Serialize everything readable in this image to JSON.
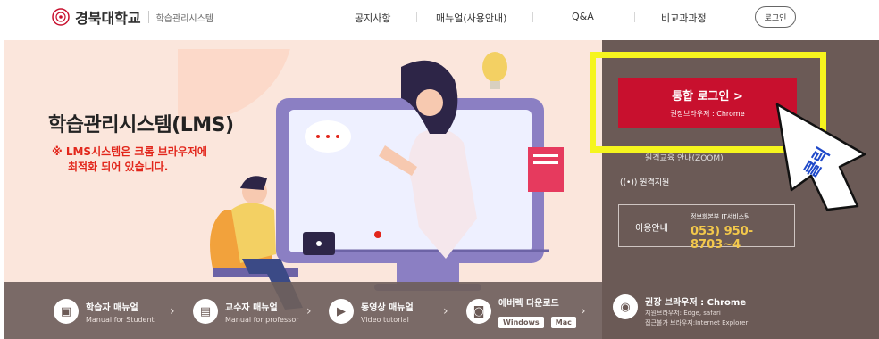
{
  "header": {
    "logo_name": "경북대학교",
    "logo_sub": "학습관리시스템",
    "nav": [
      "공지사항",
      "매뉴얼(사용안내)",
      "Q&A",
      "비교과과정"
    ],
    "login_small": "로그인"
  },
  "hero": {
    "title": "학습관리시스템(LMS)",
    "note_line1": "※ LMS시스템은 크롬 브라우저에",
    "note_line2": "최적화 되어 있습니다."
  },
  "panel": {
    "login_main": "통합 로그인 >",
    "login_sub": "권장브라우저 : Chrome",
    "item_partial": "원격교육 안내(ZOOM)",
    "item_remote": "((•)) 원격지원",
    "info_label": "이용안내",
    "info_dept": "정보화본부 IT서비스팀",
    "info_phone": "053) 950-8703~4"
  },
  "bottom": {
    "student_title": "학습자 매뉴얼",
    "student_sub": "Manual for Student",
    "prof_title": "교수자 매뉴얼",
    "prof_sub": "Manual for professor",
    "video_title": "동영상 매뉴얼",
    "video_sub": "Video tutorial",
    "download_title": "에버렉 다운로드",
    "windows": "Windows",
    "mac": "Mac",
    "browser_title": "권장 브라우저 : Chrome",
    "browser_sub1": "지원브라우저: Edge, safari",
    "browser_sub2": "접근불가 브라우저:Internet Explorer"
  },
  "annotation": {
    "arrow_text": "클릭"
  },
  "colors": {
    "accent_red": "#c8102e",
    "highlight_yellow": "#f5f51e",
    "panel_dark": "#6b5a56",
    "hero_bg": "#fbe6dc"
  },
  "icons": [
    "university-emblem-icon",
    "student-manual-icon",
    "professor-manual-icon",
    "video-icon",
    "download-icon",
    "browser-icon",
    "remote-support-icon"
  ]
}
